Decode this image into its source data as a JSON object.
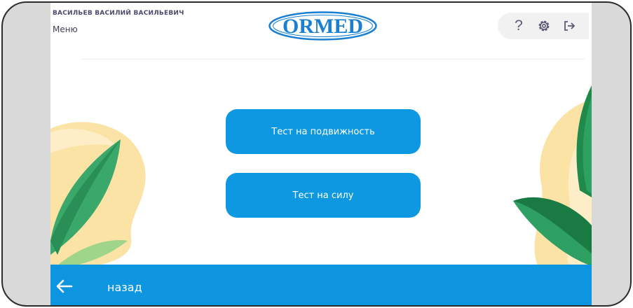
{
  "header": {
    "user_name": "ВАСИЛЬЕВ ВАСИЛИЙ ВАСИЛЬЕВИЧ",
    "menu_label": "Меню",
    "logo_text": "ORMED",
    "help_label": "?"
  },
  "icons": {
    "help": "question-mark",
    "settings": "gear-icon",
    "logout": "logout-icon",
    "back": "arrow-left-icon"
  },
  "main": {
    "buttons": [
      {
        "label": "Тест на подвижность"
      },
      {
        "label": "Тест на силу"
      }
    ]
  },
  "footer": {
    "back_label": "назад"
  },
  "colors": {
    "accent_blue": "#0e98e2",
    "bottom_bar": "#0d95e0",
    "logo_blue": "#1a7fd0",
    "leaf_green": "#2ea063",
    "blob_yellow": "#fbe3a6"
  }
}
